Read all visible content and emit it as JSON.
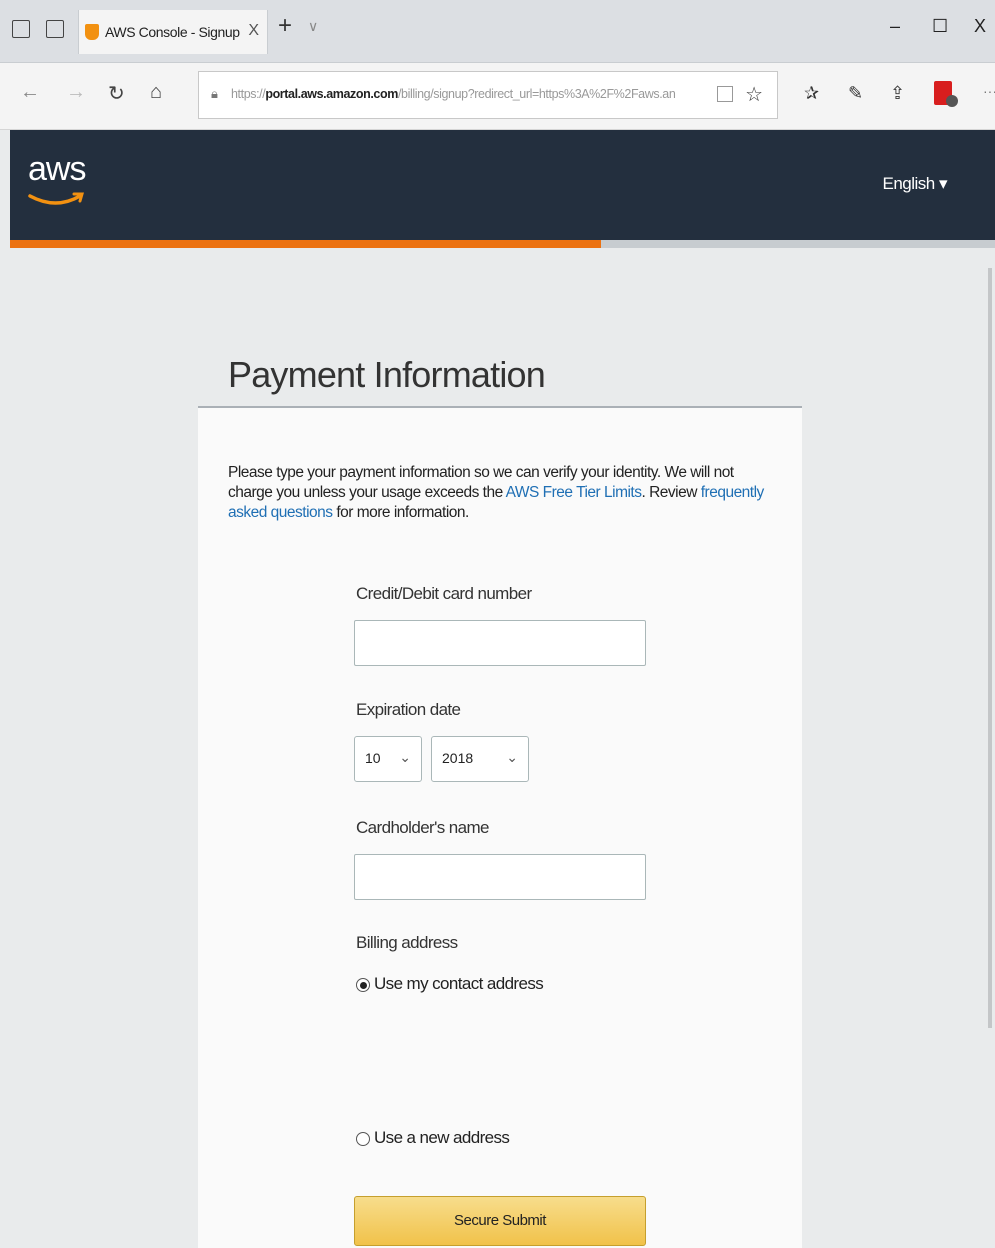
{
  "browser": {
    "tab_title": "AWS Console - Signup",
    "tab_close": "X",
    "new_tab": "+",
    "tab_menu": "∨",
    "url_prefix": "https://",
    "url_domain": "portal.aws.amazon.com",
    "url_rest": "/billing/signup?redirect_url=https%3A%2F%2Faws.an",
    "window_min": "–",
    "window_max": "☐",
    "window_close": "X"
  },
  "header": {
    "logo": "aws",
    "language": "English ▾"
  },
  "progress": {
    "fraction": 0.6
  },
  "page": {
    "title": "Payment Information",
    "intro_before": "Please type your payment information so we can verify your identity. We will not charge you unless your usage exceeds the ",
    "intro_link1": "AWS Free Tier Limits",
    "intro_mid": ". Review ",
    "intro_link2": "frequently asked questions",
    "intro_after": " for more information."
  },
  "form": {
    "card_label": "Credit/Debit card number",
    "card_value": "",
    "expiration_label": "Expiration date",
    "month_value": "10",
    "year_value": "2018",
    "cardholder_label": "Cardholder's name",
    "cardholder_value": "",
    "billing_label": "Billing address",
    "option_contact": "Use my contact address",
    "option_new": "Use a new address",
    "selected_option": "contact",
    "submit_label": "Secure Submit"
  },
  "colors": {
    "header_bg": "#232f3e",
    "accent_orange": "#ec7211",
    "link_blue": "#1f6fb4",
    "submit_yellow": "#f1c24a"
  }
}
